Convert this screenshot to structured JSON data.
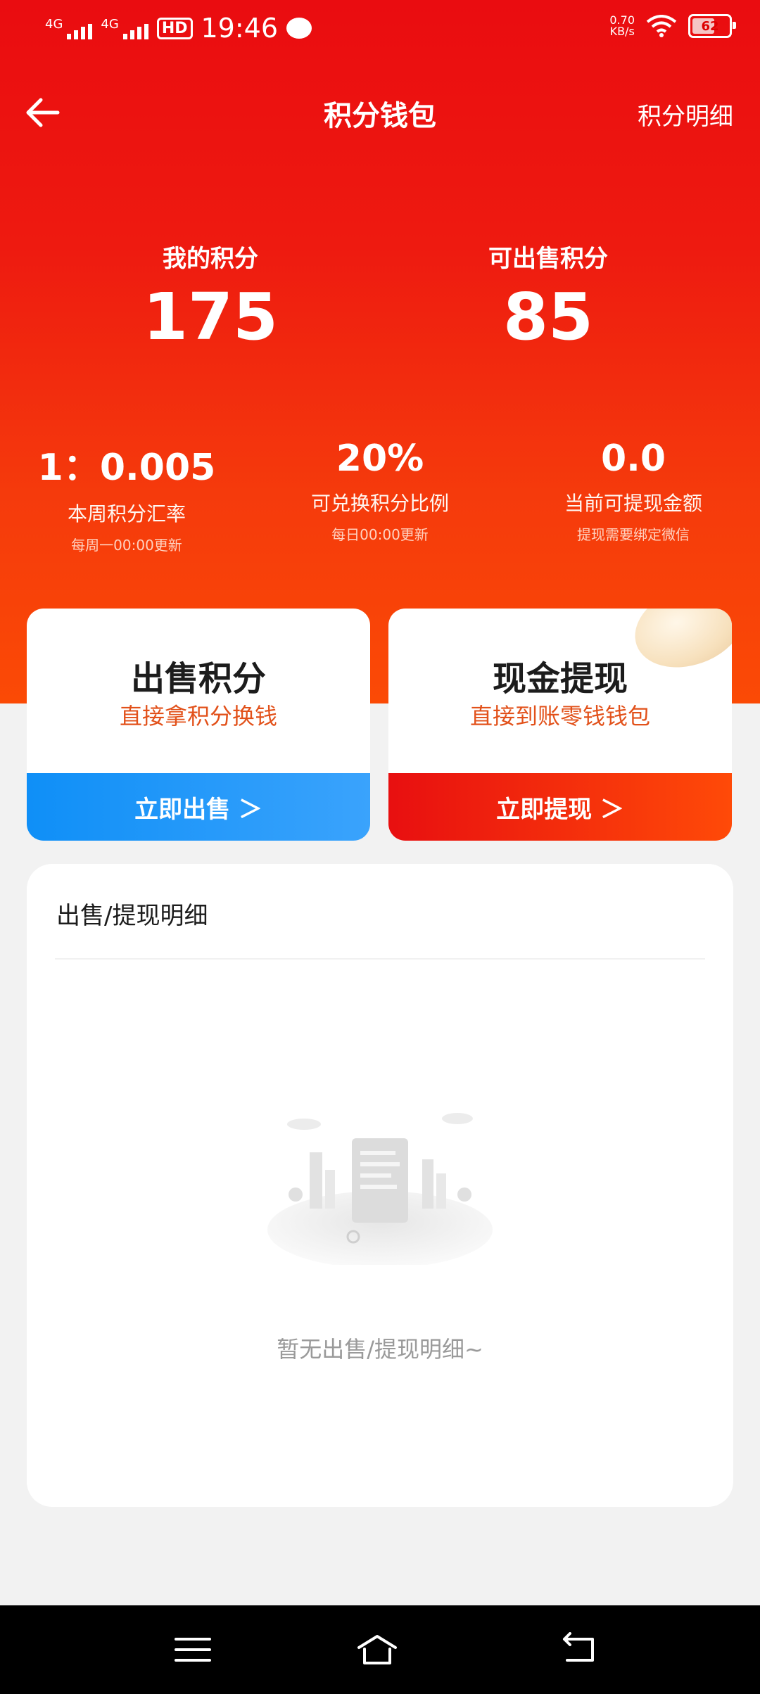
{
  "status_bar": {
    "network1": "4G",
    "network2": "4G",
    "hd": "HD",
    "time": "19:46",
    "speed_value": "0.70",
    "speed_unit": "KB/s",
    "battery": "62"
  },
  "header": {
    "title": "积分钱包",
    "detail_link": "积分明细"
  },
  "points": {
    "my_points_label": "我的积分",
    "my_points_value": "175",
    "sellable_label": "可出售积分",
    "sellable_value": "85"
  },
  "stats": [
    {
      "value": "1：0.005",
      "label": "本周积分汇率",
      "note": "每周一00:00更新"
    },
    {
      "value": "20%",
      "label": "可兑换积分比例",
      "note": "每日00:00更新"
    },
    {
      "value": "0.0",
      "label": "当前可提现金额",
      "note": "提现需要绑定微信"
    }
  ],
  "cards": {
    "sell": {
      "title": "出售积分",
      "subtitle": "直接拿积分换钱",
      "button": "立即出售 ＞"
    },
    "withdraw": {
      "title": "现金提现",
      "subtitle": "直接到账零钱钱包",
      "button": "立即提现 ＞"
    }
  },
  "details": {
    "title": "出售/提现明细",
    "empty_text": "暂无出售/提现明细~"
  },
  "colors": {
    "primary_red": "#ea0c10",
    "accent_orange": "#e2511a",
    "sell_blue": "#0f8ff7"
  },
  "icons": {
    "back": "arrow-left-icon",
    "menu": "menu-icon",
    "home": "home-icon",
    "return": "back-nav-icon"
  }
}
